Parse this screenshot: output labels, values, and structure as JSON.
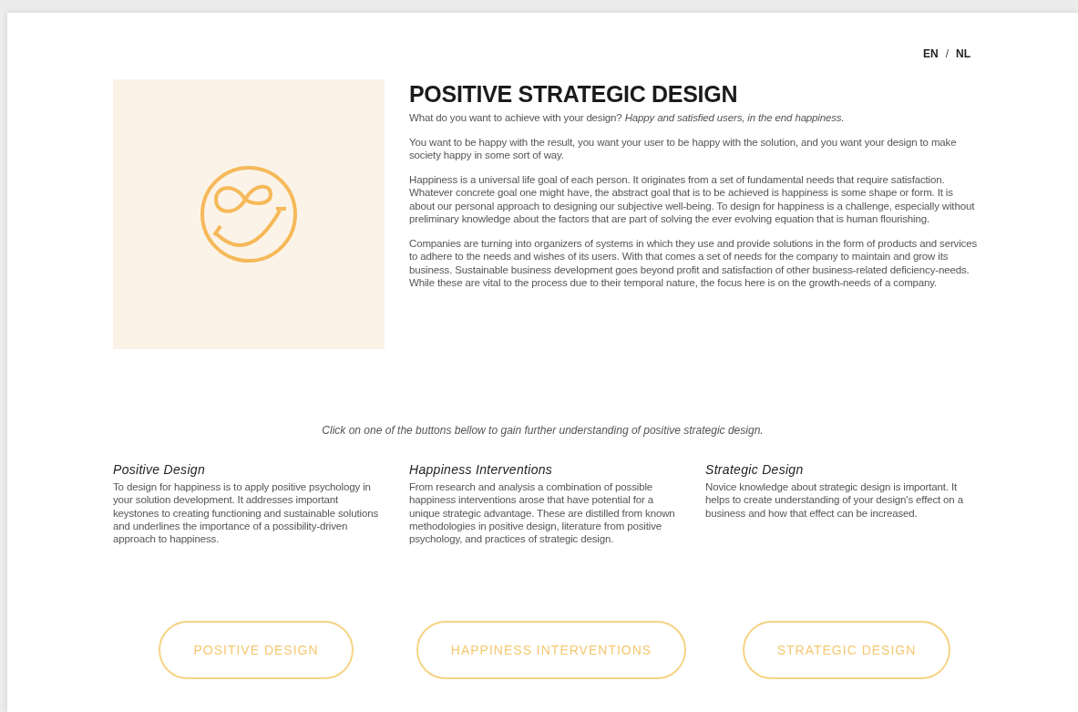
{
  "language_switch": {
    "options": [
      {
        "label": "EN"
      },
      {
        "label": "NL"
      }
    ],
    "separator": "/"
  },
  "hero": {
    "image": {
      "kind": "logo"
    },
    "title": "POSITIVE STRATEGIC DESIGN",
    "paragraphs": [
      "What do you want to achieve with your design? *Happy and satisfied users, in the end happiness.*",
      "You want to be happy with the result, you want your user to be happy with the solution, and you want your design to make society happy in some sort of way.",
      "Happiness is a universal life goal of each person. It originates from a set of fundamental needs that require satisfaction. Whatever concrete goal one might have, the abstract goal that is to be achieved is happiness is some shape or form. It is about our personal approach to designing our subjective well-being. To design for happiness is a challenge, especially without preliminary knowledge about the factors that are part of solving the ever evolving equation that is human flourishing.",
      "Companies are turning into organizers of systems in which they use and provide solutions in the form of products and services to adhere to the needs and wishes of its users. With that comes a set of needs for the company to maintain and grow its business. Sustainable business development goes beyond profit and satisfaction of other business-related deficiency-needs. While these are vital to the process due to their temporal nature, the focus here is on the growth-needs of a company."
    ]
  },
  "intro": "Click on one of the buttons bellow to gain further understanding of positive strategic design.",
  "sections": [
    {
      "title": "Positive Design",
      "text": "To design for happiness is to apply positive psychology in your solution development. It addresses important keystones to creating functioning and sustainable solutions and underlines the importance of a possibility-driven approach to happiness.",
      "button": "POSITIVE DESIGN"
    },
    {
      "title": "Happiness Interventions",
      "text": "From research and analysis a combination of possible happiness interventions arose that have potential for a unique strategic advantage. These are distilled from known methodologies in positive design, literature from positive psychology, and practices of strategic design.",
      "button": "HAPPINESS INTERVENTIONS"
    },
    {
      "title": "Strategic Design",
      "text": "Novice knowledge about strategic design is important. It helps to create understanding of your design's effect on a business and how that effect can be increased.",
      "button": "STRATEGIC DESIGN"
    }
  ]
}
